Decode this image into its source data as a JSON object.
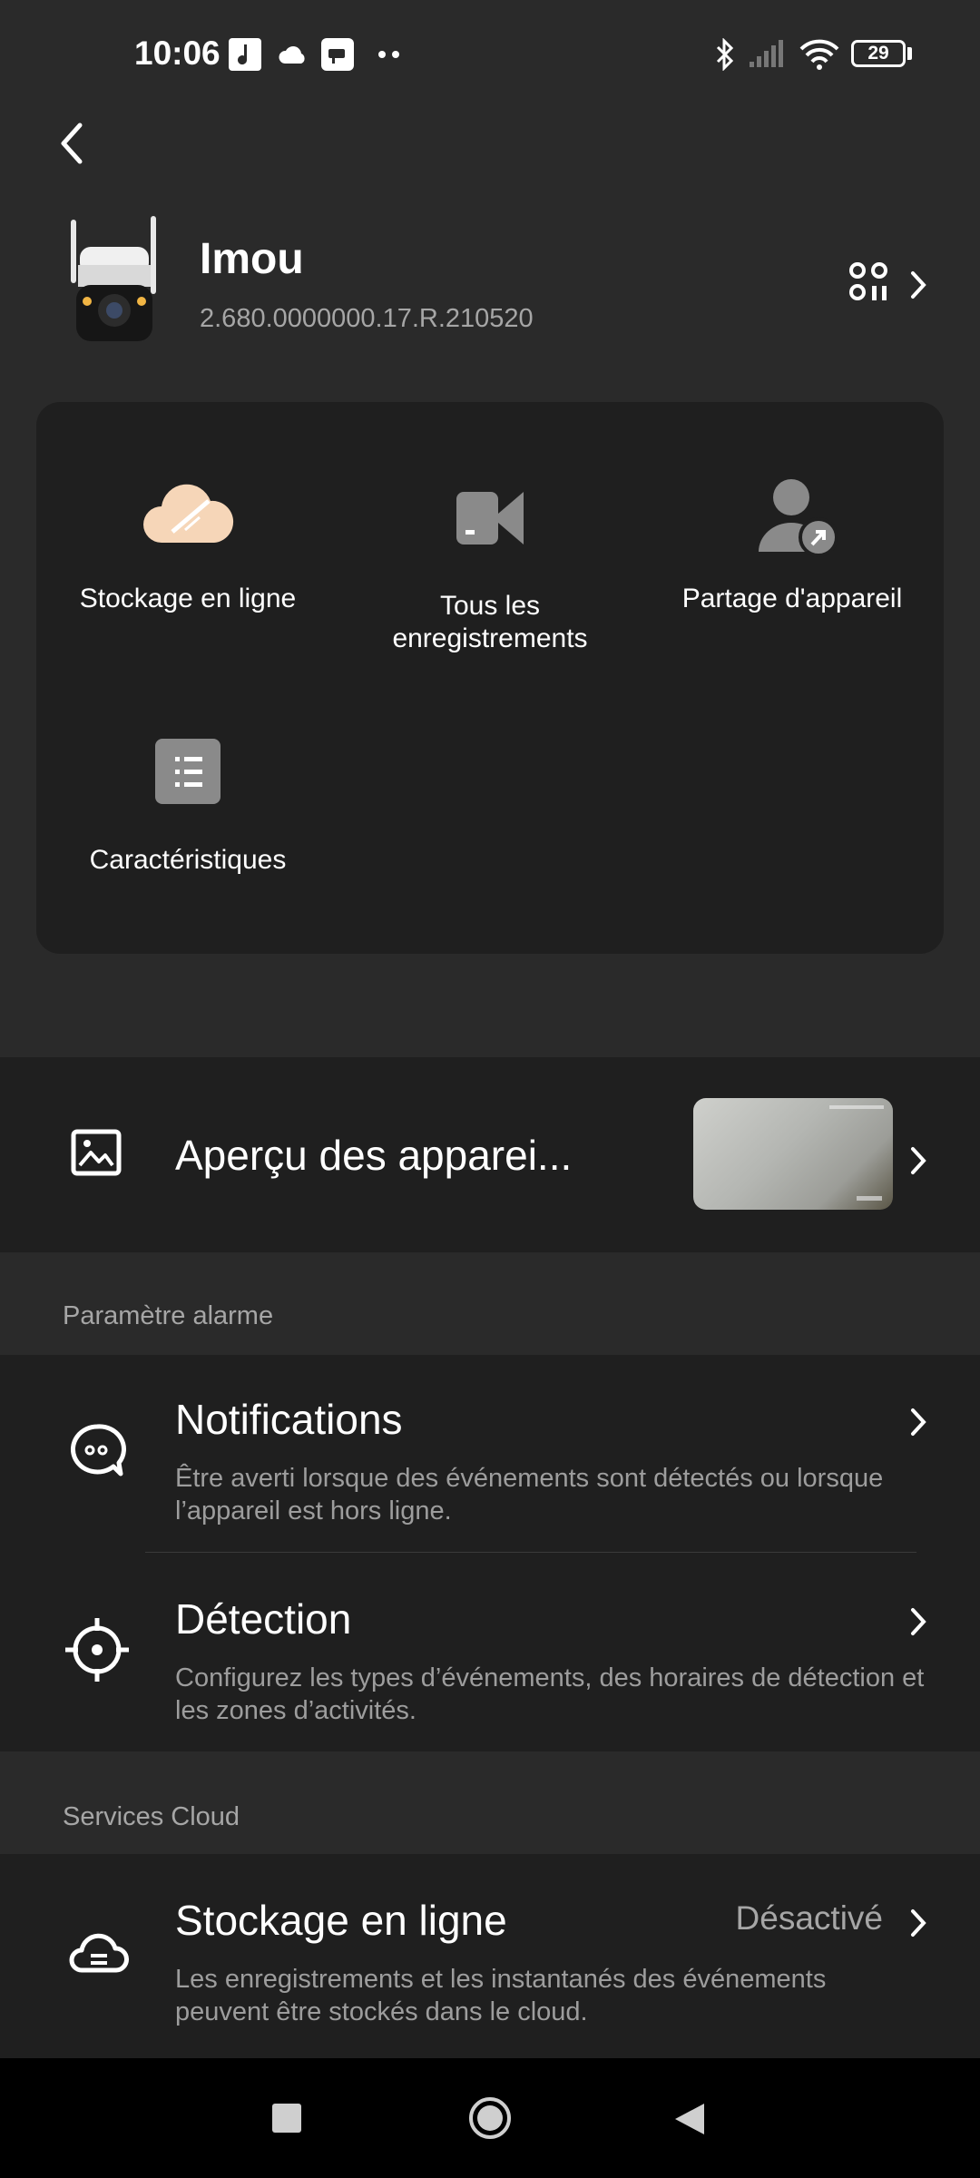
{
  "status_bar": {
    "time": "10:06",
    "battery": "29"
  },
  "device": {
    "name": "Imou",
    "firmware": "2.680.0000000.17.R.210520"
  },
  "quick_actions": [
    {
      "label": "Stockage en ligne"
    },
    {
      "label_line1": "Tous les",
      "label_line2": "enregistrements"
    },
    {
      "label": "Partage d'appareil"
    },
    {
      "label": "Caractéristiques"
    }
  ],
  "preview": {
    "label": "Aperçu des apparei..."
  },
  "alarm_section": {
    "header": "Paramètre alarme",
    "notifications": {
      "title": "Notifications",
      "desc_line1": "Être averti lorsque des événements sont détectés ou lorsque",
      "desc_line2": "l’appareil est hors ligne."
    },
    "detection": {
      "title": "Détection",
      "desc_line1": "Configurez les types d’événements, des horaires de détection et",
      "desc_line2": "les zones d’activités."
    }
  },
  "cloud_section": {
    "header": "Services Cloud",
    "storage": {
      "title": "Stockage en ligne",
      "status": "Désactivé",
      "desc_line1": "Les enregistrements et les instantanés des événements",
      "desc_line2": "peuvent être stockés dans le cloud."
    }
  },
  "colors": {
    "background": "#2a2a2a",
    "card": "#1f1f1f",
    "muted_text": "#a6a6a6",
    "cloud_accent": "#f6d6b8"
  }
}
